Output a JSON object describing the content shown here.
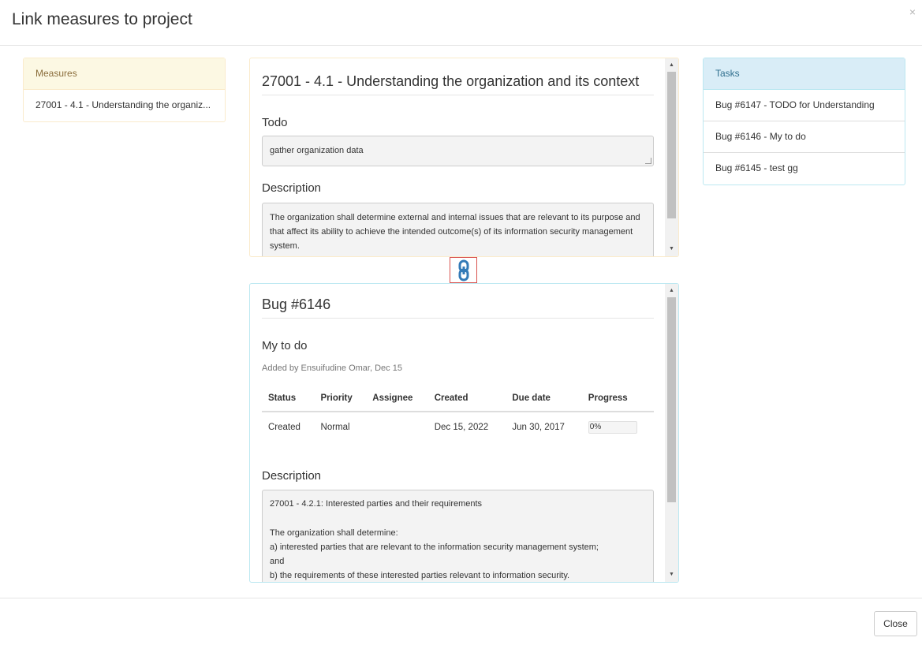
{
  "modal": {
    "title": "Link measures to project",
    "close_symbol": "×",
    "close_button_label": "Close"
  },
  "measures_panel": {
    "heading": "Measures",
    "items": [
      "27001 - 4.1 - Understanding the organiz..."
    ]
  },
  "tasks_panel": {
    "heading": "Tasks",
    "items": [
      "Bug #6147 - TODO for Understanding",
      "Bug #6146 - My to do",
      "Bug #6145 - test gg"
    ]
  },
  "measure_detail": {
    "title": "27001 - 4.1 - Understanding the organization and its context",
    "todo_label": "Todo",
    "todo_value": "gather organization data",
    "description_label": "Description",
    "description_value": "The organization shall determine external and internal issues that are relevant to its purpose and that affect its ability to achieve the intended outcome(s) of its information security management system."
  },
  "link_button": {
    "icon": "link-icon",
    "color": "#337ab7",
    "border_color": "#d9534f"
  },
  "task_detail": {
    "title": "Bug #6146",
    "subject": "My to do",
    "added_by": "Added by Ensuifudine Omar, Dec 15",
    "columns": [
      "Status",
      "Priority",
      "Assignee",
      "Created",
      "Due date",
      "Progress"
    ],
    "row": {
      "status": "Created",
      "priority": "Normal",
      "assignee": "",
      "created": "Dec 15, 2022",
      "due_date": "Jun 30, 2017",
      "progress_label": "0%",
      "progress_value": 0
    },
    "description_label": "Description",
    "description_lines": [
      "27001 - 4.2.1: Interested parties and their requirements",
      "",
      "The organization shall determine:",
      "a) interested parties that are relevant to the information security management system;",
      "and",
      "b) the requirements of these interested parties relevant to information security."
    ]
  },
  "colors": {
    "warning_bg": "#fcf8e3",
    "warning_text": "#8a6d3b",
    "info_bg": "#d9edf7",
    "info_text": "#31708f"
  }
}
